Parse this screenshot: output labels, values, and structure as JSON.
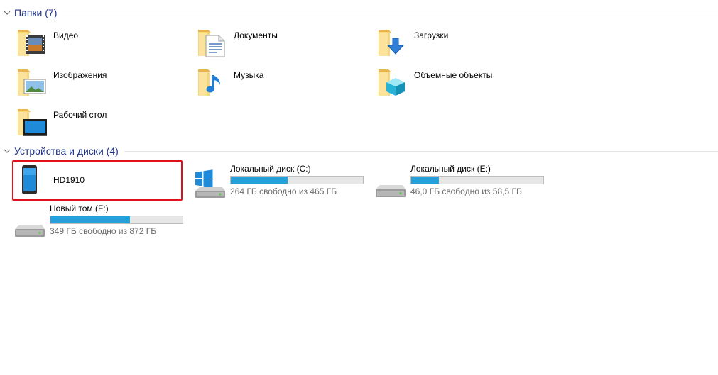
{
  "groups": {
    "folders": {
      "title": "Папки (7)"
    },
    "devices": {
      "title": "Устройства и диски (4)"
    }
  },
  "folders": [
    {
      "label": "Видео",
      "icon": "video-folder-icon"
    },
    {
      "label": "Документы",
      "icon": "documents-folder-icon"
    },
    {
      "label": "Загрузки",
      "icon": "downloads-folder-icon"
    },
    {
      "label": "Изображения",
      "icon": "pictures-folder-icon"
    },
    {
      "label": "Музыка",
      "icon": "music-folder-icon"
    },
    {
      "label": "Объемные объекты",
      "icon": "3d-objects-folder-icon"
    },
    {
      "label": "Рабочий стол",
      "icon": "desktop-folder-icon"
    }
  ],
  "device": {
    "label": "HD1910",
    "icon": "phone-icon"
  },
  "drives": [
    {
      "name": "Локальный диск (C:)",
      "free_text": "264 ГБ свободно из 465 ГБ",
      "used_fraction": 0.43,
      "icon": "windows-drive-icon"
    },
    {
      "name": "Локальный диск (E:)",
      "free_text": "46,0 ГБ свободно из 58,5 ГБ",
      "used_fraction": 0.21,
      "icon": "hard-drive-icon"
    },
    {
      "name": "Новый том (F:)",
      "free_text": "349 ГБ свободно из 872 ГБ",
      "used_fraction": 0.6,
      "icon": "hard-drive-icon"
    }
  ],
  "colors": {
    "header_text": "#1e3287",
    "bar_fill": "#26a0da",
    "highlight": "#e0111b"
  }
}
